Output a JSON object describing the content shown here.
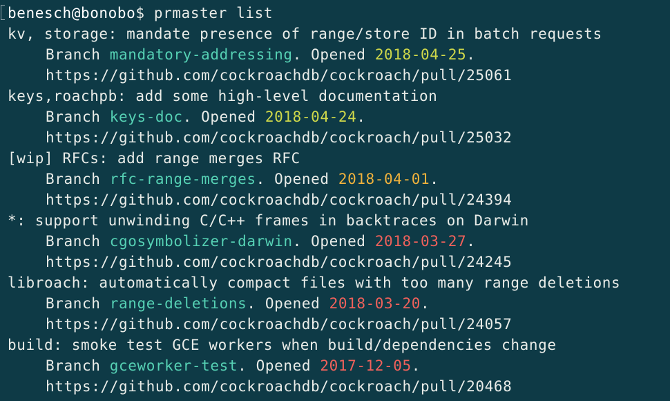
{
  "prompt": {
    "user_host": "benesch@bonobo",
    "symbol": "$",
    "command": "prmaster list"
  },
  "labels": {
    "branch_word": "Branch",
    "opened_word": "Opened"
  },
  "prs": [
    {
      "title": "kv, storage: mandate presence of range/store ID in batch requests",
      "branch": "mandatory-addressing",
      "date": "2018-04-25",
      "date_color": "#cfd84a",
      "url": "https://github.com/cockroachdb/cockroach/pull/25061"
    },
    {
      "title": "keys,roachpb: add some high-level documentation",
      "branch": "keys-doc",
      "date": "2018-04-24",
      "date_color": "#cfd84a",
      "url": "https://github.com/cockroachdb/cockroach/pull/25032"
    },
    {
      "title": "[wip] RFCs: add range merges RFC",
      "branch": "rfc-range-merges",
      "date": "2018-04-01",
      "date_color": "#f1b23c",
      "url": "https://github.com/cockroachdb/cockroach/pull/24394"
    },
    {
      "title": "*: support unwinding C/C++ frames in backtraces on Darwin",
      "branch": "cgosymbolizer-darwin",
      "date": "2018-03-27",
      "date_color": "#f0615b",
      "url": "https://github.com/cockroachdb/cockroach/pull/24245"
    },
    {
      "title": "libroach: automatically compact files with too many range deletions",
      "branch": "range-deletions",
      "date": "2018-03-20",
      "date_color": "#f0615b",
      "url": "https://github.com/cockroachdb/cockroach/pull/24057"
    },
    {
      "title": "build: smoke test GCE workers when build/dependencies change",
      "branch": "gceworker-test",
      "date": "2017-12-05",
      "date_color": "#f0615b",
      "url": "https://github.com/cockroachdb/cockroach/pull/20468"
    }
  ]
}
